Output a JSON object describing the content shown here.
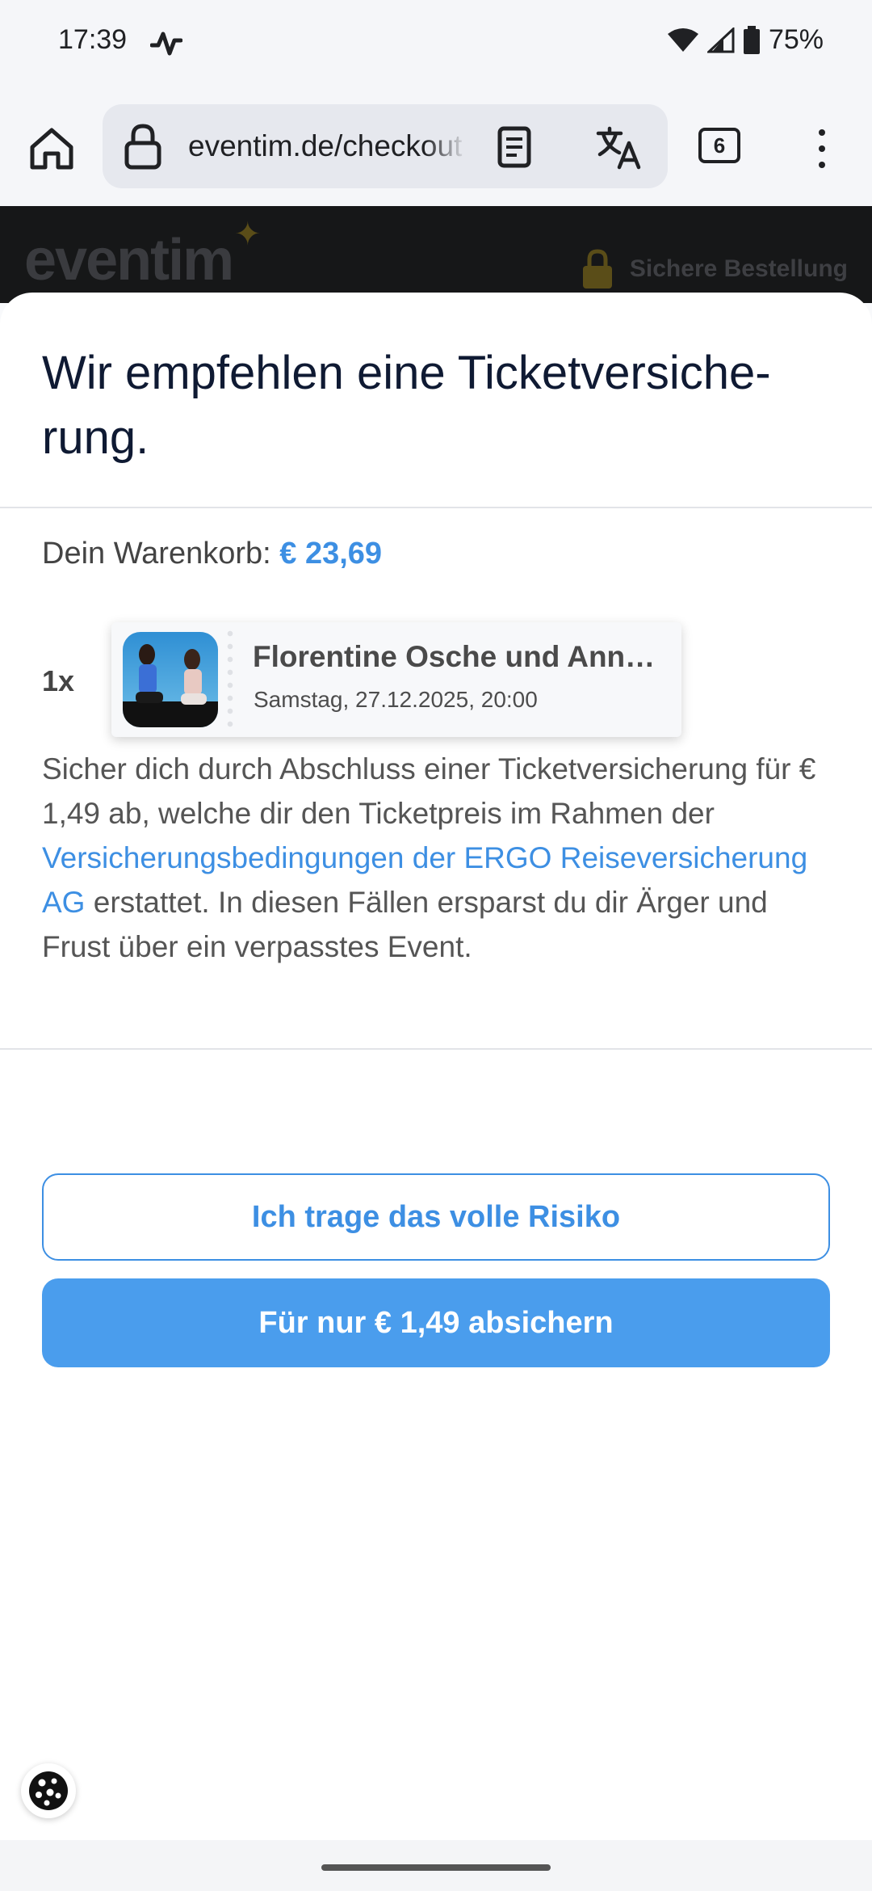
{
  "status_bar": {
    "time": "17:39",
    "battery": "75%"
  },
  "browser": {
    "url": "eventim.de/checkout",
    "tab_count": "6"
  },
  "background_page": {
    "logo": "eventim",
    "secure_label": "Sichere Bestellung"
  },
  "dialog": {
    "title": "Wir empfehlen eine Ticketversiche-rung.",
    "cart_label": "Dein Warenkorb:",
    "cart_total": "€ 23,69",
    "ticket": {
      "quantity": "1x",
      "title": "Florentine Osche und Anna...",
      "datetime": "Samstag, 27.12.2025, 20:00"
    },
    "description": {
      "before_link": "Sicher dich durch Abschluss einer Ticketversicherung für € 1,49 ab, welche dir den Ticketpreis im Rahmen der ",
      "link_text": "Versicherungsbedingungen der ERGO Reiseversicherung AG",
      "after_link": " erstattet. In diesen Fällen ersparst du dir Ärger und Frust über ein verpasstes Event."
    },
    "decline_button": "Ich trage das volle Risiko",
    "accept_button": "Für nur € 1,49 absichern"
  },
  "colors": {
    "accent": "#3d8fe3",
    "primary_button": "#4a9ded",
    "title": "#0f1a33"
  }
}
